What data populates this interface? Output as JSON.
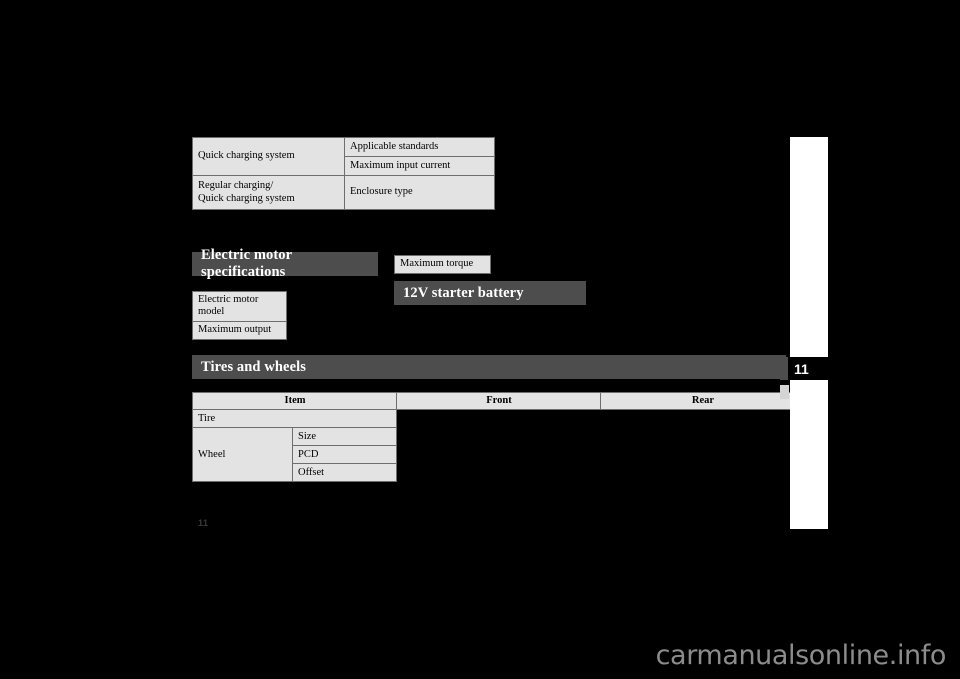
{
  "document": {
    "page_number": "11",
    "thumb_index_label": "11",
    "watermark": "carmanualsonline.info"
  },
  "charging_table": {
    "rows": [
      {
        "label": "Quick charging system",
        "value": "Applicable standards"
      },
      {
        "label": "",
        "value": "Maximum input current"
      },
      {
        "label": "Regular charging/\nQuick charging system",
        "value": "Enclosure type"
      }
    ]
  },
  "motor_section": {
    "heading": "Electric motor specifications",
    "rows": [
      {
        "label": "Electric motor model"
      },
      {
        "label": "Maximum output"
      }
    ]
  },
  "torque_table": {
    "rows": [
      {
        "label": "Maximum torque"
      }
    ]
  },
  "battery_section": {
    "heading": "12V starter battery"
  },
  "tires_section": {
    "heading": "Tires and wheels",
    "headers": {
      "item": "Item",
      "front": "Front",
      "rear": "Rear"
    },
    "rows": [
      {
        "group": "Tire",
        "sub": ""
      },
      {
        "group": "Wheel",
        "sub": "Size"
      },
      {
        "group": "",
        "sub": "PCD"
      },
      {
        "group": "",
        "sub": "Offset"
      }
    ]
  },
  "colors": {
    "page_background": "#000000",
    "band_fill": "#4d4d4d",
    "band_text": "#ffffff",
    "table_fill": "#e3e3e3",
    "table_border": "#6e6e6e",
    "thumb_strip": "#ffffff",
    "watermark_text": "#8c8c8c"
  }
}
